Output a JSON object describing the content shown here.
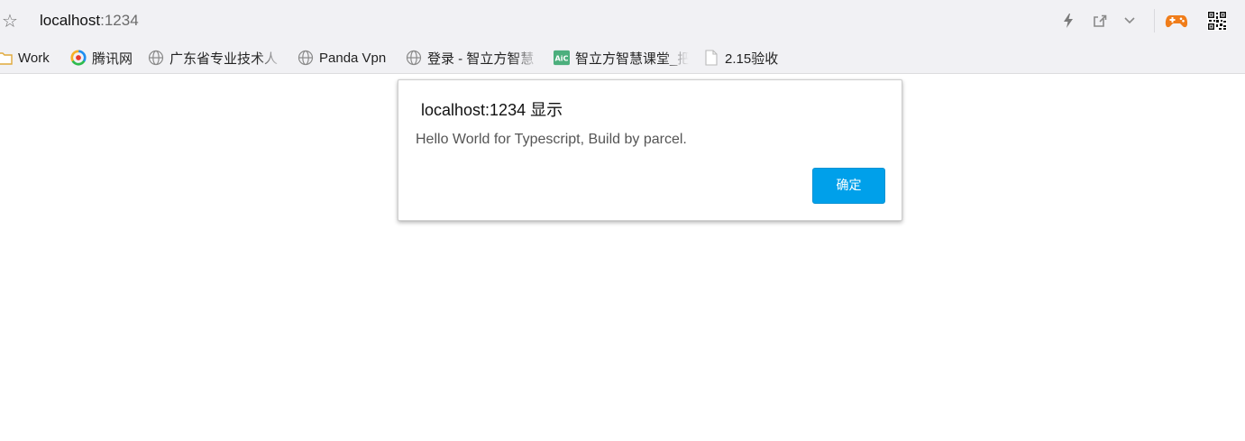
{
  "address_bar": {
    "host": "localhost",
    "port": ":1234",
    "icons": [
      "star-icon",
      "lightning-icon",
      "share-icon",
      "chevron-down-icon",
      "gamepad-icon",
      "qr-code-icon"
    ]
  },
  "bookmarks": [
    {
      "label": "Work",
      "icon": "folder-icon"
    },
    {
      "label": "腾讯网",
      "icon": "tencent-logo-icon"
    },
    {
      "label": "广东省专业技术人",
      "icon": "globe-icon"
    },
    {
      "label": "Panda Vpn",
      "icon": "globe-icon"
    },
    {
      "label": "登录 - 智立方智慧",
      "icon": "globe-icon"
    },
    {
      "label": "智立方智慧课堂_把",
      "icon": "aic-logo-icon"
    },
    {
      "label": "2.15验收",
      "icon": "page-icon"
    }
  ],
  "dialog": {
    "title": "localhost:1234 显示",
    "message": "Hello World for Typescript, Build by parcel.",
    "ok_label": "确定"
  },
  "colors": {
    "chrome_bg": "#f1f1f4",
    "ok_button": "#00a0ea",
    "gamepad": "#f07d1a",
    "aic_logo": "#4caf7d"
  }
}
